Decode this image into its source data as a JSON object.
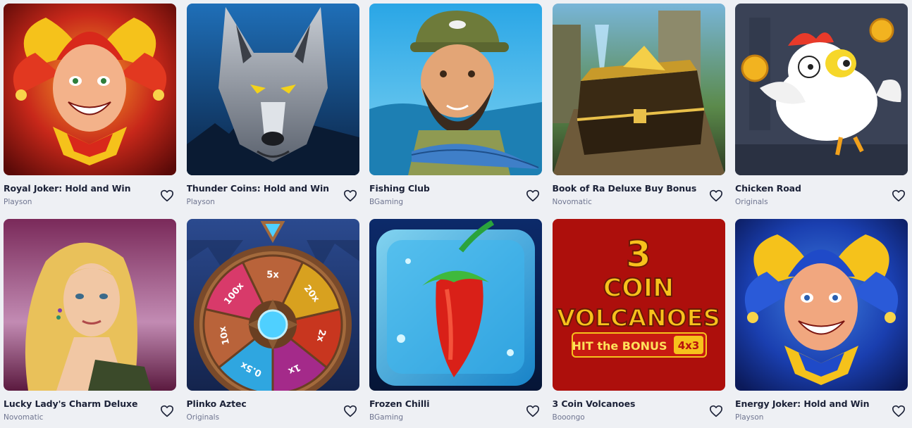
{
  "games": [
    {
      "title": "Royal Joker: Hold and Win",
      "provider": "Playson",
      "art": "joker-red"
    },
    {
      "title": "Thunder Coins: Hold and Win",
      "provider": "Playson",
      "art": "wolf"
    },
    {
      "title": "Fishing Club",
      "provider": "BGaming",
      "art": "fisherman"
    },
    {
      "title": "Book of Ra Deluxe Buy Bonus",
      "provider": "Novomatic",
      "art": "treasure-chest"
    },
    {
      "title": "Chicken Road",
      "provider": "Originals",
      "art": "chicken"
    },
    {
      "title": "Lucky Lady's Charm Deluxe",
      "provider": "Novomatic",
      "art": "lucky-lady"
    },
    {
      "title": "Plinko Aztec",
      "provider": "Originals",
      "art": "wheel"
    },
    {
      "title": "Frozen Chilli",
      "provider": "BGaming",
      "art": "frozen-chilli"
    },
    {
      "title": "3 Coin Volcanoes",
      "provider": "Booongo",
      "art": "coin-volcanoes"
    },
    {
      "title": "Energy Joker: Hold and Win",
      "provider": "Playson",
      "art": "joker-blue"
    }
  ],
  "wheel_labels": [
    "5x",
    "20x",
    "2x",
    "1x",
    "0.5x",
    "10x",
    "100x"
  ],
  "volcano_logo": {
    "line1": "3",
    "line2": "COIN",
    "line3": "VOLCANOES",
    "banner": "HIT the BONUS",
    "badge": "4x3"
  },
  "icons": {
    "favorite": "heart-outline-icon"
  },
  "colors": {
    "background": "#eef0f4",
    "title": "#1c2238",
    "provider": "#6f7590"
  }
}
